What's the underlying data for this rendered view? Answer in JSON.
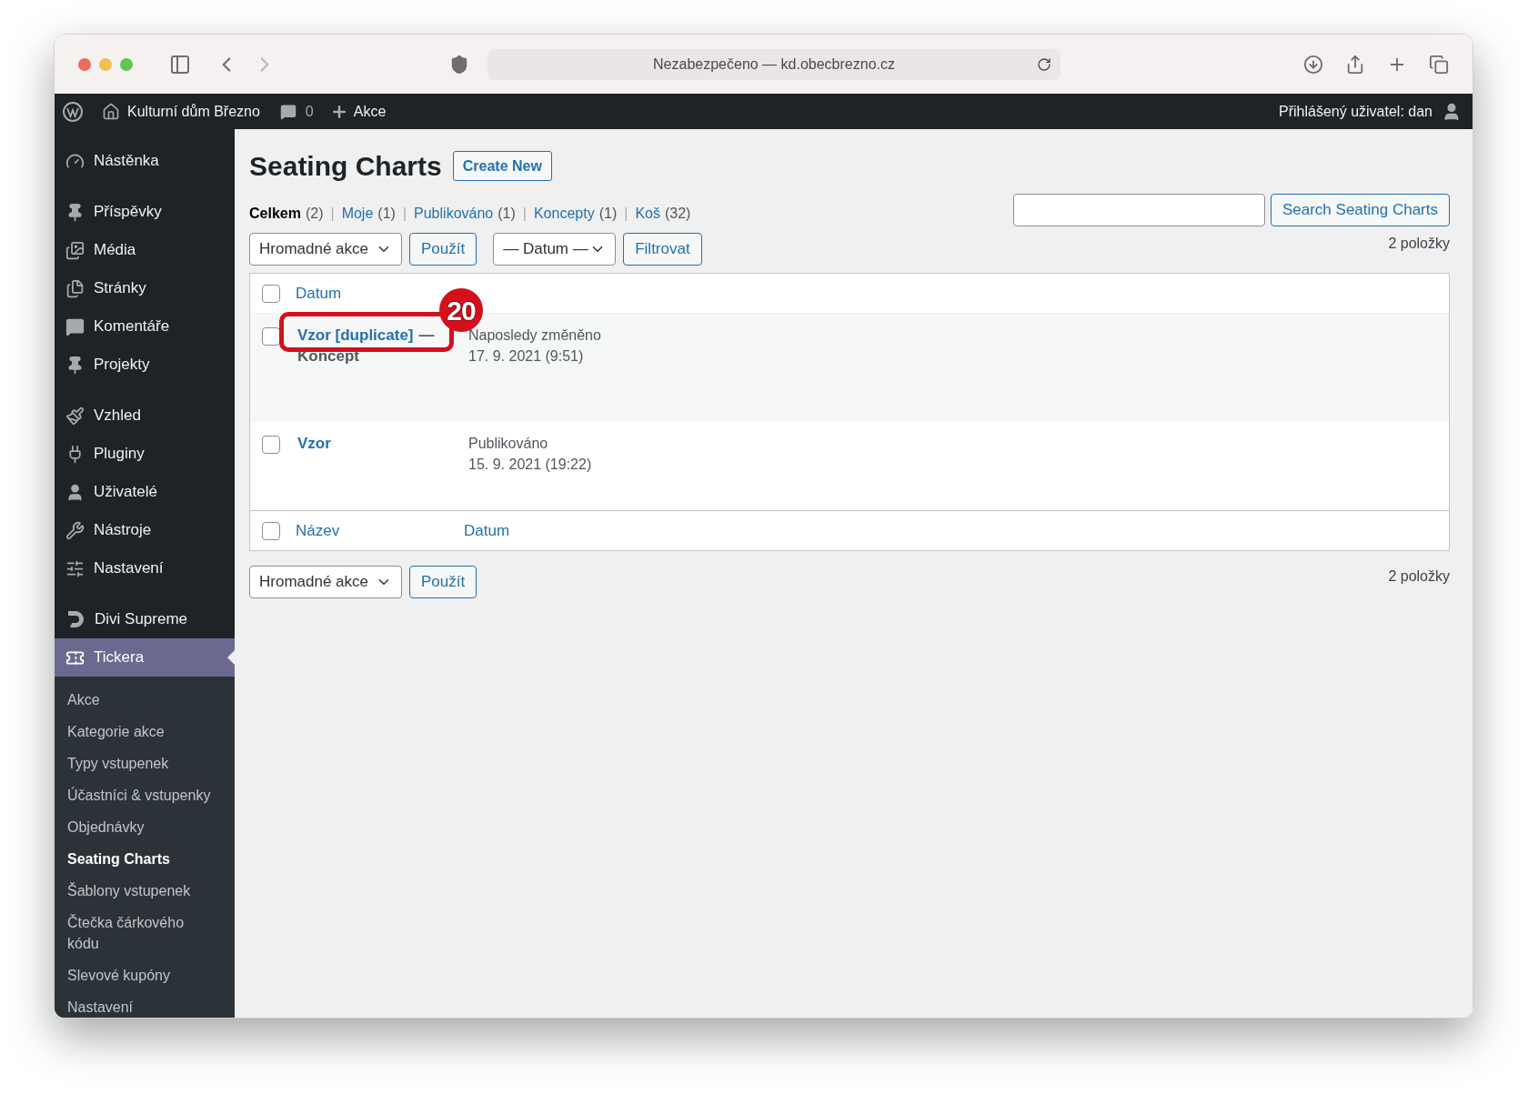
{
  "browser": {
    "url": "Nezabezpečeno — kd.obecbrezno.cz"
  },
  "admin_bar": {
    "site": "Kulturní dům Březno",
    "comments": "0",
    "new": "Akce",
    "user": "Přihlášený uživatel: dan"
  },
  "sidebar": {
    "groups": [
      {
        "items": [
          {
            "label": "Nástěnka",
            "selected": false
          }
        ]
      },
      {
        "items": [
          {
            "label": "Příspěvky",
            "selected": false
          },
          {
            "label": "Média",
            "selected": false
          },
          {
            "label": "Stránky",
            "selected": false
          },
          {
            "label": "Komentáře",
            "selected": false
          },
          {
            "label": "Projekty",
            "selected": false
          }
        ]
      },
      {
        "items": [
          {
            "label": "Vzhled",
            "selected": false
          },
          {
            "label": "Pluginy",
            "selected": false
          },
          {
            "label": "Uživatelé",
            "selected": false
          },
          {
            "label": "Nástroje",
            "selected": false
          },
          {
            "label": "Nastavení",
            "selected": false
          }
        ]
      },
      {
        "items": [
          {
            "label": "Divi Supreme",
            "selected": false
          },
          {
            "label": "Tickera",
            "selected": true,
            "children": [
              {
                "label": "Akce",
                "selected": false
              },
              {
                "label": "Kategorie akce",
                "selected": false
              },
              {
                "label": "Typy vstupenek",
                "selected": false
              },
              {
                "label": "Účastníci & vstupenky",
                "selected": false
              },
              {
                "label": "Objednávky",
                "selected": false
              },
              {
                "label": "Seating Charts",
                "selected": true
              },
              {
                "label": "Šablony vstupenek",
                "selected": false
              },
              {
                "label": "Čtečka čárkového kódu",
                "selected": false
              },
              {
                "label": "Slevové kupóny",
                "selected": false
              },
              {
                "label": "Nastavení",
                "selected": false
              }
            ]
          }
        ]
      }
    ]
  },
  "page": {
    "title": "Seating Charts",
    "create_button": "Create New",
    "views": [
      {
        "label": "Celkem",
        "count": "(2)",
        "selected": true
      },
      {
        "separator": "|",
        "label": "Moje",
        "count": "(1)",
        "selected": false
      },
      {
        "separator": "|",
        "label": "Publikováno",
        "count": "(1)",
        "selected": false
      },
      {
        "separator": "|",
        "label": "Koncepty",
        "count": "(1)",
        "selected": false
      },
      {
        "separator": "|",
        "label": "Koš",
        "count": "(32)",
        "selected": false
      }
    ],
    "search_button": "Search Seating Charts",
    "top_nav": {
      "bulk_actions": "Hromadné akce",
      "apply": "Použít",
      "date_filter": "— Datum —",
      "filter": "Filtrovat",
      "count": "2 položky"
    },
    "table": {
      "header": {
        "checked": false,
        "columns": [
          "Datum"
        ]
      },
      "rows": [
        {
          "checked": false,
          "title": "Vzor [duplicate]",
          "state_separator": "—",
          "state": "Koncept",
          "date_status": "Naposledy změněno",
          "date": "17. 9. 2021 (9:51)"
        },
        {
          "checked": false,
          "title": "Vzor",
          "date_status": "Publikováno",
          "date": "15. 9. 2021 (19:22)"
        }
      ],
      "footer": {
        "checked": false,
        "columns": [
          "Název",
          "Datum"
        ]
      }
    },
    "bottom_nav": {
      "bulk_actions": "Hromadné akce",
      "apply": "Použít",
      "count": "2 položky"
    },
    "annotation": {
      "number": "20"
    }
  }
}
